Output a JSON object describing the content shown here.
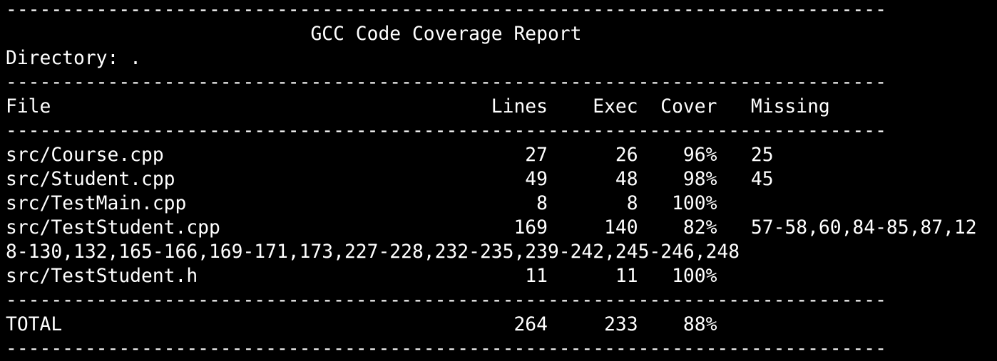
{
  "terminal": {
    "colors": {
      "background": "#000000",
      "foreground": "#ffffff"
    },
    "lines": [
      "------------------------------------------------------------------------------",
      "                           GCC Code Coverage Report",
      "Directory: .",
      "------------------------------------------------------------------------------",
      "File                                       Lines    Exec  Cover   Missing",
      "------------------------------------------------------------------------------",
      "src/Course.cpp                                27      26    96%   25",
      "src/Student.cpp                               49      48    98%   45",
      "src/TestMain.cpp                               8       8   100%",
      "src/TestStudent.cpp                          169     140    82%   57-58,60,84-85,87,12",
      "8-130,132,165-166,169-171,173,227-228,232-235,239-242,245-246,248",
      "src/TestStudent.h                             11      11   100%",
      "------------------------------------------------------------------------------",
      "TOTAL                                        264     233    88%",
      "------------------------------------------------------------------------------"
    ]
  }
}
